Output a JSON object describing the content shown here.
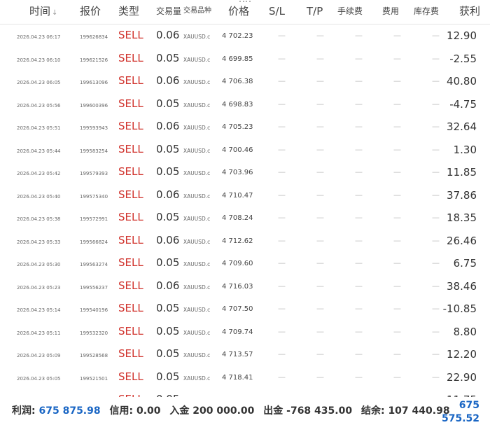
{
  "header": {
    "time": "时间",
    "sort_icon": "sort-down-icon",
    "price_label": "报价",
    "type": "类型",
    "volume": "交易量",
    "symbol": "交易品种",
    "price": "价格",
    "sl": "S/L",
    "tp": "T/P",
    "commission": "手续费",
    "fee": "费用",
    "swap": "库存费",
    "profit": "获利"
  },
  "dash": "—",
  "rows": [
    {
      "time": "2026.04.23 06:17",
      "id": "199626834",
      "type": "SELL",
      "volume": "0.06",
      "symbol": "XAUUSD.c",
      "price": "4 702.23",
      "profit": "12.90"
    },
    {
      "time": "2026.04.23 06:10",
      "id": "199621526",
      "type": "SELL",
      "volume": "0.05",
      "symbol": "XAUUSD.c",
      "price": "4 699.85",
      "profit": "-2.55"
    },
    {
      "time": "2026.04.23 06:05",
      "id": "199613096",
      "type": "SELL",
      "volume": "0.06",
      "symbol": "XAUUSD.c",
      "price": "4 706.38",
      "profit": "40.80"
    },
    {
      "time": "2026.04.23 05:56",
      "id": "199600396",
      "type": "SELL",
      "volume": "0.05",
      "symbol": "XAUUSD.c",
      "price": "4 698.83",
      "profit": "-4.75"
    },
    {
      "time": "2026.04.23 05:51",
      "id": "199593943",
      "type": "SELL",
      "volume": "0.06",
      "symbol": "XAUUSD.c",
      "price": "4 705.23",
      "profit": "32.64"
    },
    {
      "time": "2026.04.23 05:44",
      "id": "199583254",
      "type": "SELL",
      "volume": "0.05",
      "symbol": "XAUUSD.c",
      "price": "4 700.46",
      "profit": "1.30"
    },
    {
      "time": "2026.04.23 05:42",
      "id": "199579393",
      "type": "SELL",
      "volume": "0.05",
      "symbol": "XAUUSD.c",
      "price": "4 703.96",
      "profit": "11.85"
    },
    {
      "time": "2026.04.23 05:40",
      "id": "199575340",
      "type": "SELL",
      "volume": "0.06",
      "symbol": "XAUUSD.c",
      "price": "4 710.47",
      "profit": "37.86"
    },
    {
      "time": "2026.04.23 05:38",
      "id": "199572991",
      "type": "SELL",
      "volume": "0.05",
      "symbol": "XAUUSD.c",
      "price": "4 708.24",
      "profit": "18.35"
    },
    {
      "time": "2026.04.23 05:33",
      "id": "199566824",
      "type": "SELL",
      "volume": "0.06",
      "symbol": "XAUUSD.c",
      "price": "4 712.62",
      "profit": "26.46"
    },
    {
      "time": "2026.04.23 05:30",
      "id": "199563274",
      "type": "SELL",
      "volume": "0.05",
      "symbol": "XAUUSD.c",
      "price": "4 709.60",
      "profit": "6.75"
    },
    {
      "time": "2026.04.23 05:23",
      "id": "199556237",
      "type": "SELL",
      "volume": "0.06",
      "symbol": "XAUUSD.c",
      "price": "4 716.03",
      "profit": "38.46"
    },
    {
      "time": "2026.04.23 05:14",
      "id": "199540196",
      "type": "SELL",
      "volume": "0.05",
      "symbol": "XAUUSD.c",
      "price": "4 707.50",
      "profit": "-10.85"
    },
    {
      "time": "2026.04.23 05:11",
      "id": "199532320",
      "type": "SELL",
      "volume": "0.05",
      "symbol": "XAUUSD.c",
      "price": "4 709.74",
      "profit": "8.80"
    },
    {
      "time": "2026.04.23 05:09",
      "id": "199528568",
      "type": "SELL",
      "volume": "0.05",
      "symbol": "XAUUSD.c",
      "price": "4 713.57",
      "profit": "12.20"
    },
    {
      "time": "2026.04.23 05:05",
      "id": "199521501",
      "type": "SELL",
      "volume": "0.05",
      "symbol": "XAUUSD.c",
      "price": "4 718.41",
      "profit": "22.90"
    },
    {
      "time": "",
      "id": "",
      "type": "SELL",
      "volume": "0.05",
      "symbol": "",
      "price": "",
      "profit": "11.75"
    }
  ],
  "footer": {
    "profit_label": "利润:",
    "profit_value": "675 875.98",
    "credit_label": "信用:",
    "credit_value": "0.00",
    "deposit_label": "入金",
    "deposit_value": "200 000.00",
    "withdraw_label": "出金",
    "withdraw_value": "-768 435.00",
    "balance_label": "结余:",
    "balance_value": "107 440.98",
    "total_line1": "675",
    "total_line2": "575.52"
  },
  "colors": {
    "sell": "#d0322c",
    "accent": "#1a66c4"
  }
}
